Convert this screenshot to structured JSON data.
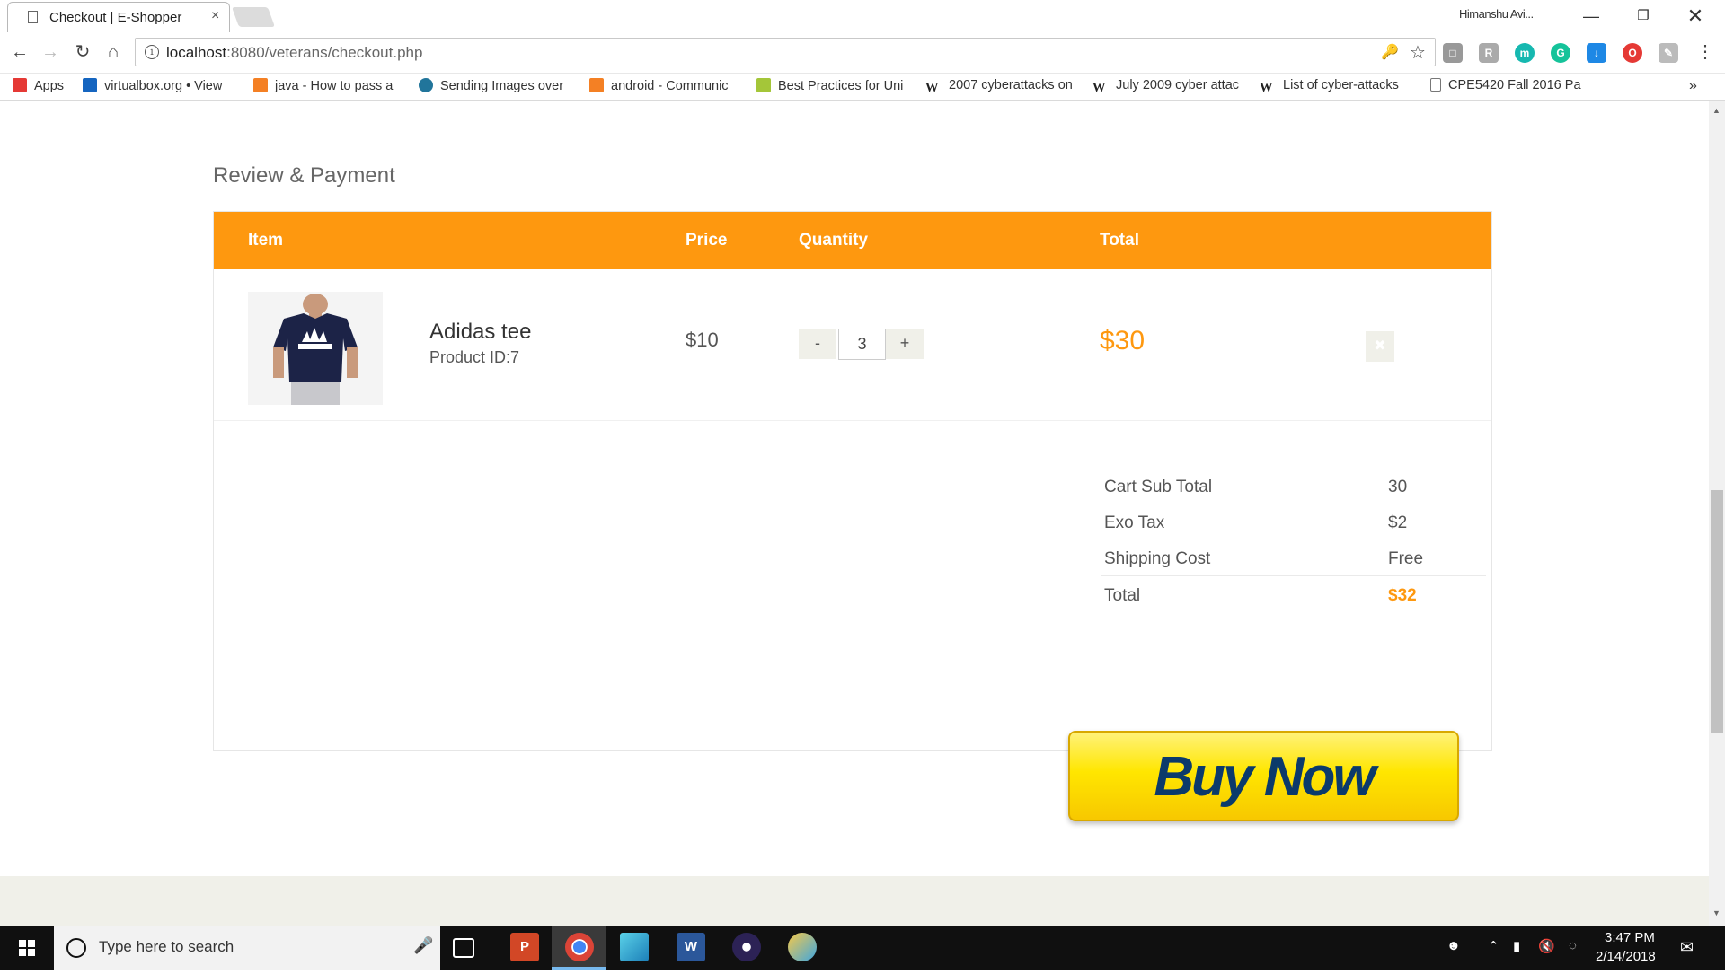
{
  "browser": {
    "tab_title": "Checkout | E-Shopper",
    "tab_close": "×",
    "profile_name": "Himanshu Avi...",
    "url_host": "localhost",
    "url_rest": ":8080/veterans/checkout.php",
    "bookmarks": [
      {
        "label": "Apps",
        "color": "#e53935"
      },
      {
        "label": "virtualbox.org • View",
        "color": "#1565c0"
      },
      {
        "label": "java - How to pass a",
        "color": "#f48024"
      },
      {
        "label": "Sending Images over",
        "color": "#21759b"
      },
      {
        "label": "android - Communic",
        "color": "#f48024"
      },
      {
        "label": "Best Practices for Uni",
        "color": "#a4c639"
      },
      {
        "label": "2007 cyberattacks on",
        "color": "#222222"
      },
      {
        "label": "July 2009 cyber attac",
        "color": "#222222"
      },
      {
        "label": "List of cyber-attacks",
        "color": "#222222"
      },
      {
        "label": "CPE5420 Fall 2016 Pa",
        "color": "#888888"
      }
    ],
    "bookmarks_more": "»"
  },
  "page": {
    "heading": "Review & Payment",
    "table_headers": {
      "item": "Item",
      "price": "Price",
      "quantity": "Quantity",
      "total": "Total"
    },
    "item": {
      "name": "Adidas tee",
      "product_id": "Product ID:7",
      "price": "$10",
      "qty_minus": "-",
      "quantity": "3",
      "qty_plus": "+",
      "line_total": "$30",
      "delete": "✖"
    },
    "summary": {
      "rows": [
        {
          "label": "Cart Sub Total",
          "value": "30"
        },
        {
          "label": "Exo Tax",
          "value": "$2"
        },
        {
          "label": "Shipping Cost",
          "value": "Free"
        }
      ],
      "total_label": "Total",
      "total_value": "$32"
    },
    "buy_now": "Buy Now"
  },
  "taskbar": {
    "search_placeholder": "Type here to search",
    "time": "3:47 PM",
    "date": "2/14/2018"
  },
  "colors": {
    "accent": "#fe980f",
    "buy_button": "#ffe600",
    "buy_text": "#0b3a6b"
  }
}
